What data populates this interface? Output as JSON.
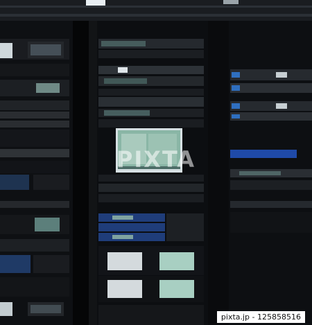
{
  "watermark": {
    "brand": "PIXTA",
    "credit": "pixta.jp - 125858516"
  }
}
